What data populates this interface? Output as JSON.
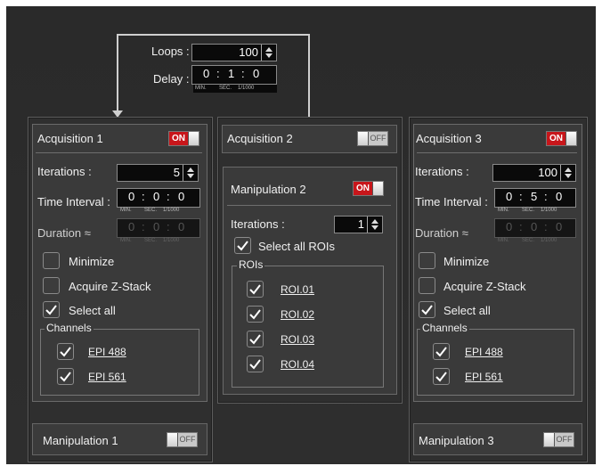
{
  "top": {
    "loops_label": "Loops :",
    "loops_value": "100",
    "delay_label": "Delay :",
    "delay": {
      "h": "0",
      "m": "1",
      "s": "0",
      "u1": "MIN.",
      "u2": "SEC.",
      "u3": "1/1000"
    }
  },
  "acq1": {
    "title": "Acquisition  1",
    "toggle": "ON",
    "iter_label": "Iterations :",
    "iter_value": "5",
    "interval_label": "Time Interval :",
    "interval": {
      "h": "0",
      "m": "0",
      "s": "0",
      "u1": "MIN.",
      "u2": "SEC.",
      "u3": "1/1000"
    },
    "duration_label": "Duration",
    "duration_symbol": "≈",
    "duration": {
      "h": "0",
      "m": "0",
      "s": "0",
      "u1": "MIN.",
      "u2": "SEC.",
      "u3": "1/1000"
    },
    "minimize": "Minimize",
    "zstack": "Acquire Z-Stack",
    "select_all": "Select all",
    "channels_label": "Channels",
    "channels": [
      "EPI 488",
      "EPI 561"
    ],
    "manip_title": "Manipulation  1",
    "manip_toggle": "OFF"
  },
  "acq2": {
    "title": "Acquisition  2",
    "toggle": "OFF",
    "manip_title": "Manipulation  2",
    "manip_toggle": "ON",
    "iter_label": "Iterations :",
    "iter_value": "1",
    "select_all_rois": "Select all ROIs",
    "rois_label": "ROIs",
    "rois": [
      "ROI.01",
      "ROI.02",
      "ROI.03",
      "ROI.04"
    ]
  },
  "acq3": {
    "title": "Acquisition  3",
    "toggle": "ON",
    "iter_label": "Iterations :",
    "iter_value": "100",
    "interval_label": "Time Interval :",
    "interval": {
      "h": "0",
      "m": "5",
      "s": "0",
      "u1": "MIN.",
      "u2": "SEC.",
      "u3": "1/1000"
    },
    "duration_label": "Duration",
    "duration_symbol": "≈",
    "duration": {
      "h": "0",
      "m": "0",
      "s": "0",
      "u1": "MIN.",
      "u2": "SEC.",
      "u3": "1/1000"
    },
    "minimize": "Minimize",
    "zstack": "Acquire Z-Stack",
    "select_all": "Select all",
    "channels_label": "Channels",
    "channels": [
      "EPI 488",
      "EPI 561"
    ],
    "manip_title": "Manipulation  3",
    "manip_toggle": "OFF"
  },
  "colors": {
    "background": "#2d2d2d",
    "toggle_on": "#c8161b",
    "field": "#0a0a0a"
  }
}
